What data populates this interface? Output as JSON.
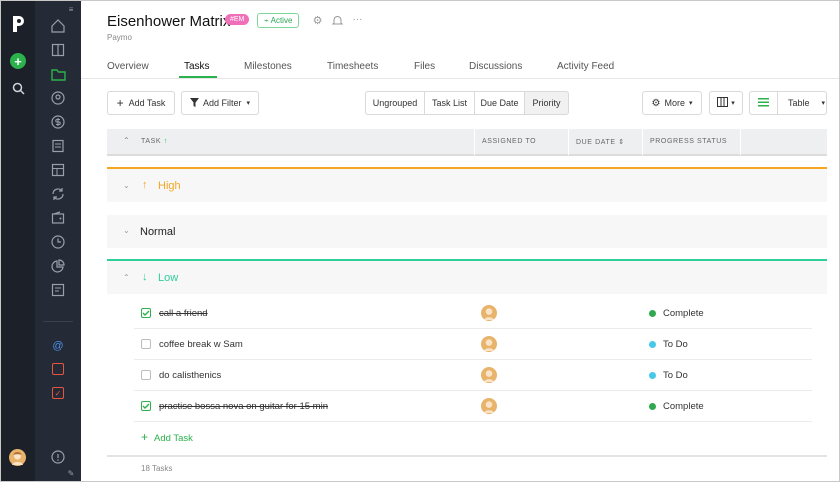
{
  "app": {
    "logo": "P"
  },
  "header": {
    "title": "Eisenhower Matrix",
    "badge": "#EM",
    "status": "Active",
    "client": "Paymo"
  },
  "tabs": [
    "Overview",
    "Tasks",
    "Milestones",
    "Timesheets",
    "Files",
    "Discussions",
    "Activity Feed"
  ],
  "toolbar": {
    "add_task": "Add Task",
    "add_filter": "Add Filter",
    "groupings": [
      "Ungrouped",
      "Task List",
      "Due Date",
      "Priority"
    ],
    "more": "More",
    "view": "Table"
  },
  "columns": {
    "task": "TASK",
    "assigned": "ASSIGNED TO",
    "due": "DUE DATE",
    "progress": "PROGRESS STATUS"
  },
  "groups": {
    "high": "High",
    "normal": "Normal",
    "low": "Low"
  },
  "tasks": [
    {
      "name": "call a friend",
      "done": true,
      "status": "Complete"
    },
    {
      "name": "coffee break w Sam",
      "done": false,
      "status": "To Do"
    },
    {
      "name": "do calisthenics",
      "done": false,
      "status": "To Do"
    },
    {
      "name": "practise bossa nova on guitar for 15 min",
      "done": true,
      "status": "Complete"
    }
  ],
  "add_task_inline": "Add Task",
  "footer": {
    "count": "18 Tasks"
  },
  "colors": {
    "high": "#f5a623",
    "low": "#2fcf9b",
    "complete": "#2fa84f",
    "todo": "#46c8e8",
    "brand": "#2bb24c"
  }
}
